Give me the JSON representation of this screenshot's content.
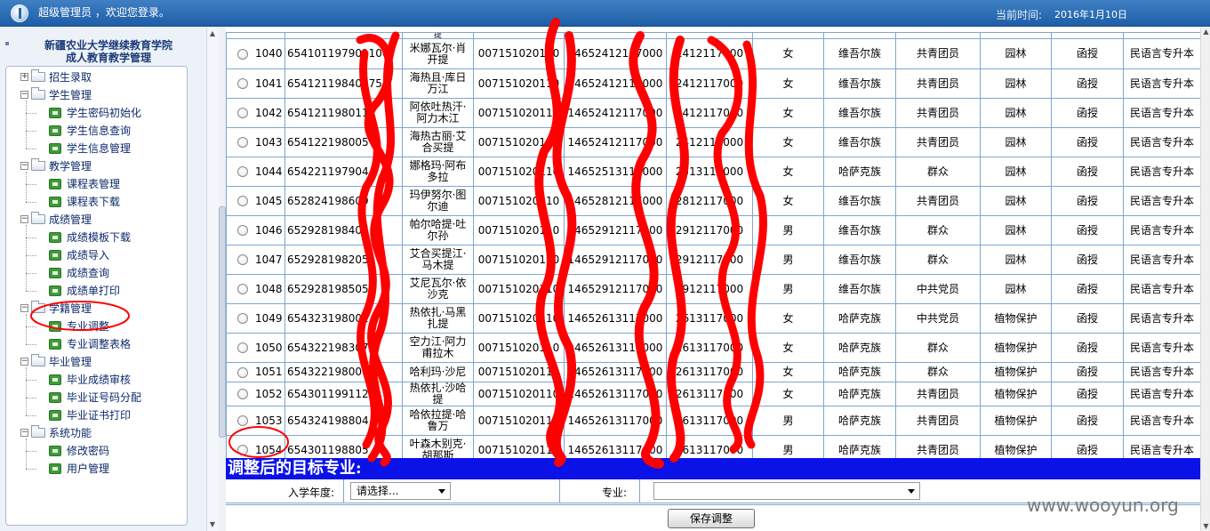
{
  "header": {
    "greeting": "超级管理员 ，欢迎您登录。",
    "time_label": "当前时间:",
    "time_value": "2016年1月10日"
  },
  "sidebar": {
    "title_line1": "新疆农业大学继续教育学院",
    "title_line2": "成人教育教学管理",
    "groups": [
      {
        "label": "招生录取",
        "collapsed": true,
        "items": []
      },
      {
        "label": "学生管理",
        "collapsed": false,
        "items": [
          "学生密码初始化",
          "学生信息查询",
          "学生信息管理"
        ]
      },
      {
        "label": "教学管理",
        "collapsed": false,
        "items": [
          "课程表管理",
          "课程表下载"
        ]
      },
      {
        "label": "成绩管理",
        "collapsed": false,
        "items": [
          "成绩模板下载",
          "成绩导入",
          "成绩查询",
          "成绩单打印"
        ]
      },
      {
        "label": "学籍管理",
        "collapsed": false,
        "items": [
          "专业调整",
          "专业调整表格"
        ]
      },
      {
        "label": "毕业管理",
        "collapsed": false,
        "items": [
          "毕业成绩审核",
          "毕业证号码分配",
          "毕业证书打印"
        ]
      },
      {
        "label": "系统功能",
        "collapsed": false,
        "items": [
          "修改密码",
          "用户管理"
        ]
      }
    ]
  },
  "table": {
    "top_partial": "提",
    "rows": [
      {
        "no": "1040",
        "idcard": "654101197901100",
        "name": "米娜瓦尔·肖开提",
        "code1": "007151020110",
        "code2": "14652412117000",
        "code3": "2412117000",
        "gender": "女",
        "ethnic": "维吾尔族",
        "political": "共青团员",
        "major": "园林",
        "form": "函授",
        "level": "民语言专升本"
      },
      {
        "no": "1041",
        "idcard": "654121198400752",
        "name": "海热且·库日万江",
        "code1": "007151020110",
        "code2": "14652412117000",
        "code3": "2412117000",
        "gender": "女",
        "ethnic": "维吾尔族",
        "political": "共青团员",
        "major": "园林",
        "form": "函授",
        "level": "民语言专升本"
      },
      {
        "no": "1042",
        "idcard": "654121198011",
        "name": "阿依吐热汗·阿力木江",
        "code1": "007151020110",
        "code2": "14652412117000",
        "code3": "2412117000",
        "gender": "女",
        "ethnic": "维吾尔族",
        "political": "共青团员",
        "major": "园林",
        "form": "函授",
        "level": "民语言专升本"
      },
      {
        "no": "1043",
        "idcard": "654122198005",
        "name": "海热古丽·艾合买提",
        "code1": "007151020110",
        "code2": "14652412117000",
        "code3": "2412117000",
        "gender": "女",
        "ethnic": "维吾尔族",
        "political": "共青团员",
        "major": "园林",
        "form": "函授",
        "level": "民语言专升本"
      },
      {
        "no": "1044",
        "idcard": "654221197904",
        "name": "娜格玛·阿布多拉",
        "code1": "007151020110",
        "code2": "14652513117000",
        "code3": "2513117000",
        "gender": "女",
        "ethnic": "哈萨克族",
        "political": "群众",
        "major": "园林",
        "form": "函授",
        "level": "民语言专升本"
      },
      {
        "no": "1045",
        "idcard": "652824198609",
        "name": "玛伊努尔·图尔迪",
        "code1": "007151020110",
        "code2": "14652812117000",
        "code3": "2812117000",
        "gender": "女",
        "ethnic": "维吾尔族",
        "political": "共青团员",
        "major": "园林",
        "form": "函授",
        "level": "民语言专升本"
      },
      {
        "no": "1046",
        "idcard": "652928198407",
        "name": "帕尔哈提·吐尔孙",
        "code1": "007151020110",
        "code2": "14652912117000",
        "code3": "2912117000",
        "gender": "男",
        "ethnic": "维吾尔族",
        "political": "群众",
        "major": "园林",
        "form": "函授",
        "level": "民语言专升本"
      },
      {
        "no": "1047",
        "idcard": "652928198205",
        "name": "艾合买提江·马木提",
        "code1": "007151020110",
        "code2": "14652912117000",
        "code3": "2912117000",
        "gender": "男",
        "ethnic": "维吾尔族",
        "political": "群众",
        "major": "园林",
        "form": "函授",
        "level": "民语言专升本"
      },
      {
        "no": "1048",
        "idcard": "652928198505",
        "name": "艾尼瓦尔·依沙克",
        "code1": "007151020110",
        "code2": "14652912117000",
        "code3": "2912117000",
        "gender": "男",
        "ethnic": "维吾尔族",
        "political": "中共党员",
        "major": "园林",
        "form": "函授",
        "level": "民语言专升本"
      },
      {
        "no": "1049",
        "idcard": "654323198002",
        "name": "热依扎·马黑扎提",
        "code1": "007151020110",
        "code2": "14652613117000",
        "code3": "2613117000",
        "gender": "女",
        "ethnic": "哈萨克族",
        "political": "中共党员",
        "major": "植物保护",
        "form": "函授",
        "level": "民语言专升本"
      },
      {
        "no": "1050",
        "idcard": "654322198307",
        "name": "空力江·阿力甫拉木",
        "code1": "007151020110",
        "code2": "14652613117000",
        "code3": "2613117000",
        "gender": "女",
        "ethnic": "哈萨克族",
        "political": "群众",
        "major": "植物保护",
        "form": "函授",
        "level": "民语言专升本"
      },
      {
        "no": "1051",
        "idcard": "654322198006",
        "name": "哈利玛·沙尼",
        "code1": "007151020110",
        "code2": "14652613117000",
        "code3": "2613117000",
        "gender": "女",
        "ethnic": "哈萨克族",
        "political": "群众",
        "major": "植物保护",
        "form": "函授",
        "level": "民语言专升本"
      },
      {
        "no": "1052",
        "idcard": "654301199112",
        "name": "热依扎·沙哈提",
        "code1": "007151020110",
        "code2": "14652613117000",
        "code3": "2613117000",
        "gender": "女",
        "ethnic": "哈萨克族",
        "political": "共青团员",
        "major": "植物保护",
        "form": "函授",
        "level": "民语言专升本"
      },
      {
        "no": "1053",
        "idcard": "654324198804",
        "name": "哈依拉提·哈鲁万",
        "code1": "007151020110",
        "code2": "14652613117000",
        "code3": "2613117000",
        "gender": "男",
        "ethnic": "哈萨克族",
        "political": "共青团员",
        "major": "植物保护",
        "form": "函授",
        "level": "民语言专升本"
      },
      {
        "no": "1054",
        "idcard": "654301198805",
        "name": "叶森木别克·胡那斯",
        "code1": "007151020110",
        "code2": "14652613117000",
        "code3": "2613117000",
        "gender": "男",
        "ethnic": "哈萨克族",
        "political": "共青团员",
        "major": "植物保护",
        "form": "函授",
        "level": "民语言专升本"
      }
    ]
  },
  "target": {
    "title": "调整后的目标专业:",
    "year_label": "入学年度:",
    "year_value": "请选择...",
    "major_label": "专业:",
    "major_value": "",
    "save_label": "保存调整"
  },
  "watermark": "www.wooyun.org",
  "colors": {
    "redaction": "#ff0000",
    "target_bar": "#0b12e8",
    "header": "#2a6ab3"
  }
}
